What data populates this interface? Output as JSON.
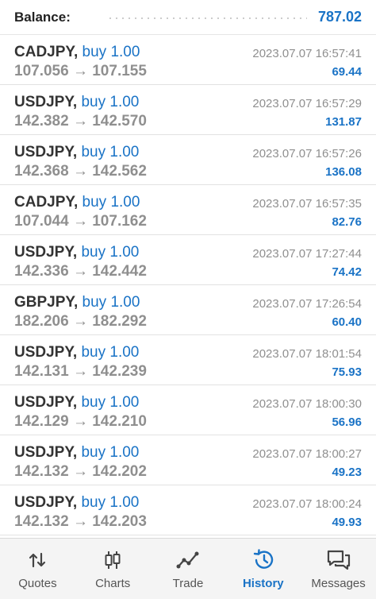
{
  "balance": {
    "label": "Balance:",
    "value": "787.02"
  },
  "trades": [
    {
      "pair": "CADJPY,",
      "side": "buy 1.00",
      "prices": "107.056 → 107.155",
      "time": "2023.07.07 16:57:41",
      "profit": "69.44"
    },
    {
      "pair": "USDJPY,",
      "side": "buy 1.00",
      "prices": "142.382 → 142.570",
      "time": "2023.07.07 16:57:29",
      "profit": "131.87"
    },
    {
      "pair": "USDJPY,",
      "side": "buy 1.00",
      "prices": "142.368 → 142.562",
      "time": "2023.07.07 16:57:26",
      "profit": "136.08"
    },
    {
      "pair": "CADJPY,",
      "side": "buy 1.00",
      "prices": "107.044 → 107.162",
      "time": "2023.07.07 16:57:35",
      "profit": "82.76"
    },
    {
      "pair": "USDJPY,",
      "side": "buy 1.00",
      "prices": "142.336 → 142.442",
      "time": "2023.07.07 17:27:44",
      "profit": "74.42"
    },
    {
      "pair": "GBPJPY,",
      "side": "buy 1.00",
      "prices": "182.206 → 182.292",
      "time": "2023.07.07 17:26:54",
      "profit": "60.40"
    },
    {
      "pair": "USDJPY,",
      "side": "buy 1.00",
      "prices": "142.131 → 142.239",
      "time": "2023.07.07 18:01:54",
      "profit": "75.93"
    },
    {
      "pair": "USDJPY,",
      "side": "buy 1.00",
      "prices": "142.129 → 142.210",
      "time": "2023.07.07 18:00:30",
      "profit": "56.96"
    },
    {
      "pair": "USDJPY,",
      "side": "buy 1.00",
      "prices": "142.132 → 142.202",
      "time": "2023.07.07 18:00:27",
      "profit": "49.23"
    },
    {
      "pair": "USDJPY,",
      "side": "buy 1.00",
      "prices": "142.132 → 142.203",
      "time": "2023.07.07 18:00:24",
      "profit": "49.93"
    }
  ],
  "tabs": [
    {
      "label": "Quotes",
      "icon": "quotes-icon"
    },
    {
      "label": "Charts",
      "icon": "candlestick-chart-icon"
    },
    {
      "label": "Trade",
      "icon": "trade-line-icon"
    },
    {
      "label": "History",
      "icon": "history-clock-icon",
      "active": true
    },
    {
      "label": "Messages",
      "icon": "messages-icon"
    }
  ],
  "colors": {
    "accent": "#1a73c6",
    "muted": "#8f8f8f"
  }
}
